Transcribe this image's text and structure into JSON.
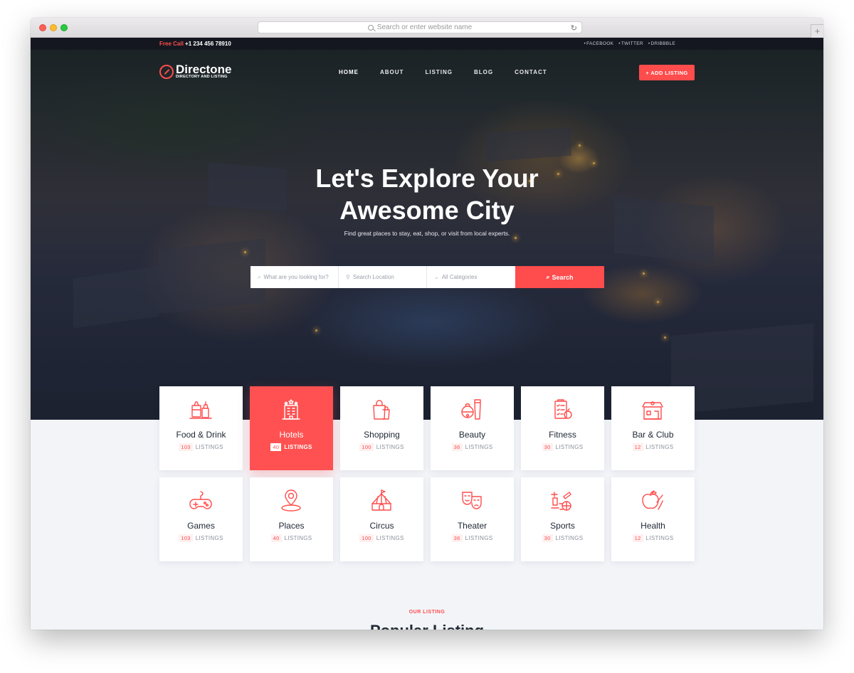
{
  "browser": {
    "address_placeholder": "Search or enter website name"
  },
  "topbar": {
    "free_call_label": "Free Call",
    "phone": "+1 234 456 78910",
    "social": [
      "FACEBOOK",
      "TWITTER",
      "DRIBBBLE"
    ]
  },
  "logo": {
    "name": "Directone",
    "tagline": "DIRECTORY AND LISTING"
  },
  "nav": {
    "items": [
      "HOME",
      "ABOUT",
      "LISTING",
      "BLOG",
      "CONTACT"
    ],
    "active": "HOME",
    "cta": "+ ADD LISTING"
  },
  "hero": {
    "title_line1": "Let's Explore Your",
    "title_line2": "Awesome City",
    "subtitle": "Find great places to stay, eat, shop, or visit from local experts."
  },
  "search": {
    "what_placeholder": "What are you looking for?",
    "location_placeholder": "Search Location",
    "category_placeholder": "All Categories",
    "button": "Search"
  },
  "categories": [
    {
      "name": "Food & Drink",
      "count": "103",
      "unit": "LISTINGS",
      "icon": "food-drink-icon"
    },
    {
      "name": "Hotels",
      "count": "40",
      "unit": "LISTINGS",
      "icon": "hotel-icon"
    },
    {
      "name": "Shopping",
      "count": "100",
      "unit": "LISTINGS",
      "icon": "shopping-bag-icon"
    },
    {
      "name": "Beauty",
      "count": "36",
      "unit": "LISTINGS",
      "icon": "beauty-icon"
    },
    {
      "name": "Fitness",
      "count": "30",
      "unit": "LISTINGS",
      "icon": "fitness-icon"
    },
    {
      "name": "Bar & Club",
      "count": "12",
      "unit": "LISTINGS",
      "icon": "bar-club-icon"
    },
    {
      "name": "Games",
      "count": "103",
      "unit": "LISTINGS",
      "icon": "gamepad-icon"
    },
    {
      "name": "Places",
      "count": "40",
      "unit": "LISTINGS",
      "icon": "map-pin-icon"
    },
    {
      "name": "Circus",
      "count": "100",
      "unit": "LISTINGS",
      "icon": "circus-tent-icon"
    },
    {
      "name": "Theater",
      "count": "36",
      "unit": "LISTINGS",
      "icon": "theater-masks-icon"
    },
    {
      "name": "Sports",
      "count": "30",
      "unit": "LISTINGS",
      "icon": "sports-icon"
    },
    {
      "name": "Health",
      "count": "12",
      "unit": "LISTINGS",
      "icon": "health-icon"
    }
  ],
  "active_category": "Hotels",
  "section": {
    "eyebrow": "OUR LISTING",
    "title": "Popular Listing"
  },
  "colors": {
    "accent": "#ff4c4c",
    "topbar": "#14171f",
    "page_bg": "#f2f4f8"
  }
}
